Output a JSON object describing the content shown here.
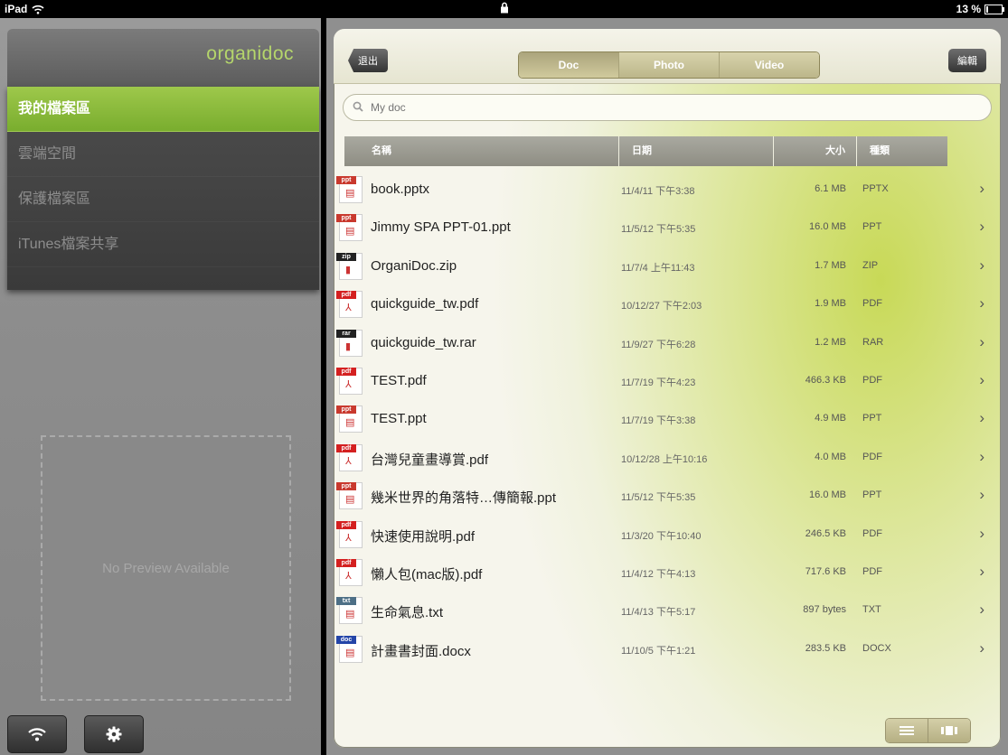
{
  "status_bar": {
    "device": "iPad",
    "battery": "13 %",
    "battery_level": 0.13
  },
  "sidebar": {
    "logo": "organidoc",
    "items": [
      {
        "label": "我的檔案區",
        "active": true
      },
      {
        "label": "雲端空間",
        "active": false
      },
      {
        "label": "保護檔案區",
        "active": false
      },
      {
        "label": "iTunes檔案共享",
        "active": false
      }
    ],
    "preview_text": "No Preview Available",
    "wifi_icon": "wifi-icon",
    "settings_icon": "gear-icon"
  },
  "toolbar": {
    "back_label": "退出",
    "tabs": [
      "Doc",
      "Photo",
      "Video"
    ],
    "active_tab": "Doc",
    "edit_label": "編輯"
  },
  "search": {
    "placeholder": "My doc"
  },
  "table": {
    "columns": [
      "名稱",
      "日期",
      "大小",
      "種類"
    ],
    "rows": [
      {
        "name": "book.pptx",
        "date": "11/4/11 下午3:38",
        "size": "6.1 MB",
        "type": "PPTX",
        "tag": "ppt",
        "color": "#c9392e"
      },
      {
        "name": "Jimmy SPA PPT-01.ppt",
        "date": "11/5/12 下午5:35",
        "size": "16.0 MB",
        "type": "PPT",
        "tag": "ppt",
        "color": "#c9392e"
      },
      {
        "name": "OrganiDoc.zip",
        "date": "11/7/4 上午11:43",
        "size": "1.7 MB",
        "type": "ZIP",
        "tag": "zip",
        "color": "#222222"
      },
      {
        "name": "quickguide_tw.pdf",
        "date": "10/12/27 下午2:03",
        "size": "1.9 MB",
        "type": "PDF",
        "tag": "pdf",
        "color": "#d42020"
      },
      {
        "name": "quickguide_tw.rar",
        "date": "11/9/27 下午6:28",
        "size": "1.2 MB",
        "type": "RAR",
        "tag": "rar",
        "color": "#222222"
      },
      {
        "name": "TEST.pdf",
        "date": "11/7/19 下午4:23",
        "size": "466.3 KB",
        "type": "PDF",
        "tag": "pdf",
        "color": "#d42020"
      },
      {
        "name": "TEST.ppt",
        "date": "11/7/19 下午3:38",
        "size": "4.9 MB",
        "type": "PPT",
        "tag": "ppt",
        "color": "#c9392e"
      },
      {
        "name": "台灣兒童畫導賞.pdf",
        "date": "10/12/28 上午10:16",
        "size": "4.0 MB",
        "type": "PDF",
        "tag": "pdf",
        "color": "#d42020"
      },
      {
        "name": "幾米世界的角落特…傳簡報.ppt",
        "date": "11/5/12 下午5:35",
        "size": "16.0 MB",
        "type": "PPT",
        "tag": "ppt",
        "color": "#c9392e"
      },
      {
        "name": "快速使用說明.pdf",
        "date": "11/3/20 下午10:40",
        "size": "246.5 KB",
        "type": "PDF",
        "tag": "pdf",
        "color": "#d42020"
      },
      {
        "name": "懶人包(mac版).pdf",
        "date": "11/4/12 下午4:13",
        "size": "717.6 KB",
        "type": "PDF",
        "tag": "pdf",
        "color": "#d42020"
      },
      {
        "name": "生命氣息.txt",
        "date": "11/4/13 下午5:17",
        "size": "897 bytes",
        "type": "TXT",
        "tag": "txt",
        "color": "#4d6f86"
      },
      {
        "name": "計畫書封面.docx",
        "date": "11/10/5 下午1:21",
        "size": "283.5 KB",
        "type": "DOCX",
        "tag": "doc",
        "color": "#2445a8"
      }
    ]
  },
  "view_toggle": {
    "list_icon": "list-view-icon",
    "grid_icon": "thumbnail-view-icon"
  }
}
